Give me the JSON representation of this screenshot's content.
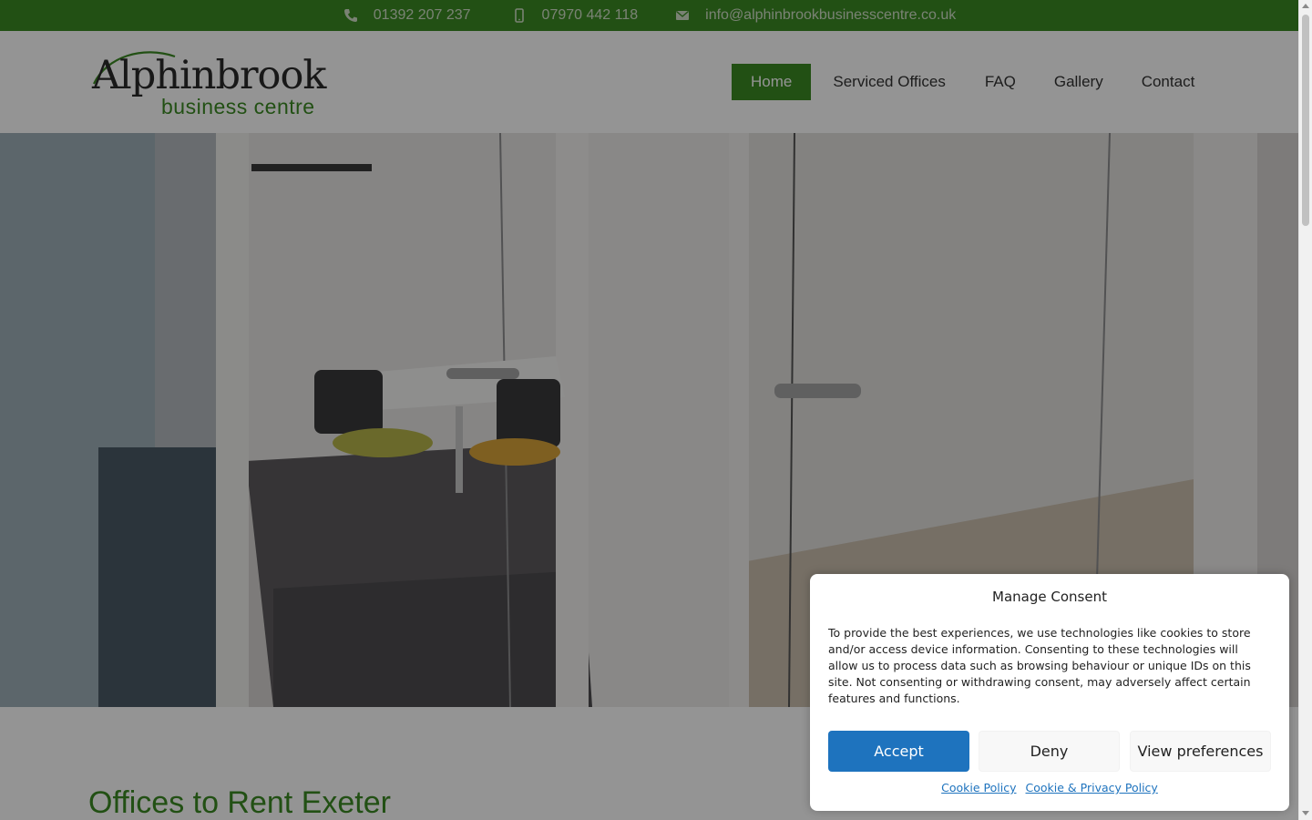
{
  "topbar": {
    "phone": "01392 207 237",
    "mobile": "07970 442 118",
    "email": "info@alphinbrookbusinesscentre.co.uk",
    "icons": [
      "phone-icon",
      "mobile-icon",
      "envelope-icon"
    ],
    "bg_color": "#3b8a24"
  },
  "header": {
    "logo_brand": "Alphinbrook",
    "logo_sub": "business centre",
    "nav": [
      {
        "label": "Home",
        "active": true
      },
      {
        "label": "Serviced Offices",
        "active": false
      },
      {
        "label": "FAQ",
        "active": false
      },
      {
        "label": "Gallery",
        "active": false
      },
      {
        "label": "Contact",
        "active": false
      }
    ],
    "accent_color": "#3b8a24"
  },
  "main": {
    "heading": "Offices to Rent Exeter"
  },
  "consent": {
    "title": "Manage Consent",
    "body": "To provide the best experiences, we use technologies like cookies to store and/or access device information. Consenting to these technologies will allow us to process data such as browsing behaviour or unique IDs on this site. Not consenting or withdrawing consent, may adversely affect certain features and functions.",
    "accept_label": "Accept",
    "deny_label": "Deny",
    "prefs_label": "View preferences",
    "cookie_policy_link": "Cookie Policy",
    "privacy_policy_link": "Cookie & Privacy Policy",
    "accept_color": "#1e73be"
  }
}
